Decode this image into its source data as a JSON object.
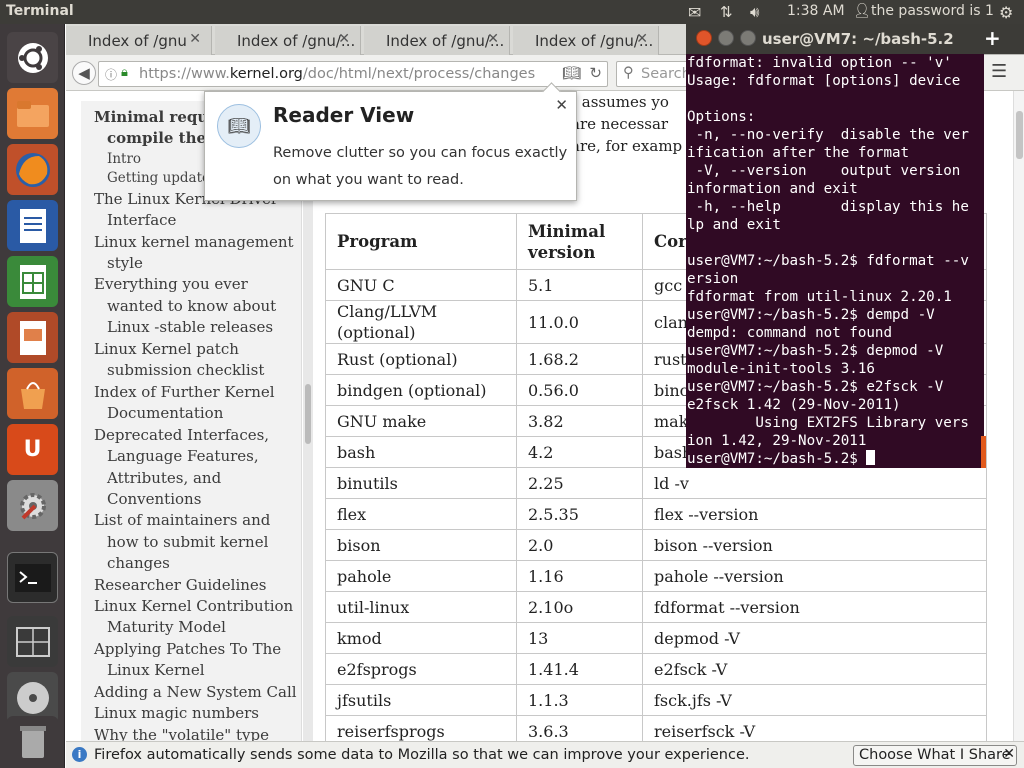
{
  "top_panel": {
    "app_title": "Terminal",
    "clock": "1:38 AM",
    "user": "the password is 1"
  },
  "launcher": {
    "items": [
      {
        "name": "ubuntu-dash"
      },
      {
        "name": "files"
      },
      {
        "name": "firefox"
      },
      {
        "name": "writer"
      },
      {
        "name": "calc"
      },
      {
        "name": "impress"
      },
      {
        "name": "software-center"
      },
      {
        "name": "ubuntu-one"
      },
      {
        "name": "system-settings"
      },
      {
        "name": "terminal"
      },
      {
        "name": "workspace-switcher"
      },
      {
        "name": "dvd"
      },
      {
        "name": "trash"
      }
    ]
  },
  "browser": {
    "tabs": [
      {
        "label": "Index of /gnu"
      },
      {
        "label": "Index of /gnu/..."
      },
      {
        "label": "Index of /gnu/..."
      },
      {
        "label": "Index of /gnu/..."
      }
    ],
    "url_prefix": "https://www.",
    "url_domain": "kernel.org",
    "url_suffix": "/doc/html/next/process/changes",
    "search_placeholder": "Search",
    "sidebar": [
      {
        "text": "Minimal requi",
        "bold": true
      },
      {
        "text": "compile the",
        "bold": true
      },
      {
        "text": "Intro"
      },
      {
        "text": "Getting update"
      },
      {
        "text": "The Linux Kernel Driver"
      },
      {
        "text": "Interface"
      },
      {
        "text": "Linux kernel management"
      },
      {
        "text": "style"
      },
      {
        "text": "Everything you ever"
      },
      {
        "text": "wanted to know about"
      },
      {
        "text": "Linux -stable releases"
      },
      {
        "text": "Linux Kernel patch"
      },
      {
        "text": "submission checklist"
      },
      {
        "text": "Index of Further Kernel"
      },
      {
        "text": "Documentation"
      },
      {
        "text": "Deprecated Interfaces,"
      },
      {
        "text": "Language Features,"
      },
      {
        "text": "Attributes, and"
      },
      {
        "text": "Conventions"
      },
      {
        "text": "List of maintainers and"
      },
      {
        "text": "how to submit kernel"
      },
      {
        "text": "changes"
      },
      {
        "text": "Researcher Guidelines"
      },
      {
        "text": "Linux Kernel Contribution"
      },
      {
        "text": "Maturity Model"
      },
      {
        "text": "Applying Patches To The"
      },
      {
        "text": "Linux Kernel"
      },
      {
        "text": "Adding a New System Call"
      },
      {
        "text": "Linux magic numbers"
      },
      {
        "text": "Why the \"volatile\" type"
      }
    ],
    "main_text": {
      "line1": "t assumes yo",
      "line2": "are necessar",
      "line3": "are, for examp"
    },
    "table": {
      "headers": [
        "Program",
        "Minimal version",
        "Cor"
      ],
      "rows": [
        [
          "GNU C",
          "5.1",
          "gcc"
        ],
        [
          "Clang/LLVM (optional)",
          "11.0.0",
          "clan"
        ],
        [
          "Rust (optional)",
          "1.68.2",
          "rust"
        ],
        [
          "bindgen (optional)",
          "0.56.0",
          "binc"
        ],
        [
          "GNU make",
          "3.82",
          "mak"
        ],
        [
          "bash",
          "4.2",
          "bash"
        ],
        [
          "binutils",
          "2.25",
          "ld -v"
        ],
        [
          "flex",
          "2.5.35",
          "flex --version"
        ],
        [
          "bison",
          "2.0",
          "bison --version"
        ],
        [
          "pahole",
          "1.16",
          "pahole --version"
        ],
        [
          "util-linux",
          "2.10o",
          "fdformat --version"
        ],
        [
          "kmod",
          "13",
          "depmod -V"
        ],
        [
          "e2fsprogs",
          "1.41.4",
          "e2fsck -V"
        ],
        [
          "jfsutils",
          "1.1.3",
          "fsck.jfs -V"
        ],
        [
          "reiserfsprogs",
          "3.6.3",
          "reiserfsck -V"
        ]
      ]
    },
    "reader_popup": {
      "title": "Reader View",
      "message": "Remove clutter so you can focus exactly on what you want to read."
    },
    "notification": {
      "text": "Firefox automatically sends some data to Mozilla so that we can improve your experience.",
      "button": "Choose What I Share"
    }
  },
  "terminal": {
    "title": "user@VM7: ~/bash-5.2",
    "lines": [
      "fdformat: invalid option -- 'v'",
      "Usage: fdformat [options] device",
      "",
      "Options:",
      " -n, --no-verify  disable the ver",
      "ification after the format",
      " -V, --version    output version",
      "information and exit",
      " -h, --help       display this he",
      "lp and exit",
      "",
      "user@VM7:~/bash-5.2$ fdformat --v",
      "ersion",
      "fdformat from util-linux 2.20.1",
      "user@VM7:~/bash-5.2$ dempd -V",
      "dempd: command not found",
      "user@VM7:~/bash-5.2$ depmod -V",
      "module-init-tools 3.16",
      "user@VM7:~/bash-5.2$ e2fsck -V",
      "e2fsck 1.42 (29-Nov-2011)",
      "        Using EXT2FS Library vers",
      "ion 1.42, 29-Nov-2011"
    ],
    "prompt": "user@VM7:~/bash-5.2$ "
  }
}
